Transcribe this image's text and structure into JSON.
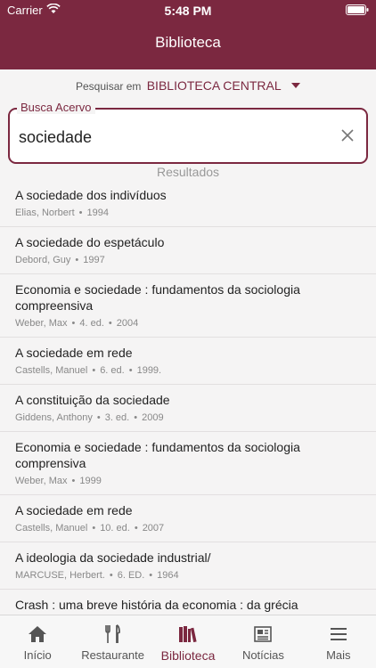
{
  "status_bar": {
    "carrier": "Carrier",
    "time": "5:48 PM"
  },
  "header": {
    "title": "Biblioteca"
  },
  "search": {
    "scope_label": "Pesquisar em",
    "scope_value": "BIBLIOTECA CENTRAL",
    "field_label": "Busca Acervo",
    "value": "sociedade"
  },
  "results": {
    "header": "Resultados",
    "items": [
      {
        "title": "A sociedade dos indivíduos",
        "meta": [
          "Elias, Norbert",
          "1994"
        ]
      },
      {
        "title": "A sociedade do espetáculo",
        "meta": [
          "Debord, Guy",
          "1997"
        ]
      },
      {
        "title": "Economia e sociedade : fundamentos da sociologia compreensiva",
        "meta": [
          "Weber, Max",
          "4. ed.",
          "2004"
        ]
      },
      {
        "title": "A sociedade em rede",
        "meta": [
          "Castells, Manuel",
          "6. ed.",
          "1999."
        ]
      },
      {
        "title": "A constituição da sociedade",
        "meta": [
          "Giddens, Anthony",
          "3. ed.",
          "2009"
        ]
      },
      {
        "title": "Economia e sociedade : fundamentos da sociologia comprensiva",
        "meta": [
          "Weber, Max",
          "1999"
        ]
      },
      {
        "title": "A sociedade em rede",
        "meta": [
          "Castells, Manuel",
          "10. ed.",
          "2007"
        ]
      },
      {
        "title": "A ideologia da sociedade industrial/",
        "meta": [
          "MARCUSE, Herbert.",
          "6. ED.",
          "1964"
        ]
      },
      {
        "title": "Crash : uma breve história da economia : da grécia",
        "meta": []
      }
    ]
  },
  "tabs": [
    {
      "label": "Início",
      "icon": "home-icon"
    },
    {
      "label": "Restaurante",
      "icon": "fork-knife-icon"
    },
    {
      "label": "Biblioteca",
      "icon": "books-icon"
    },
    {
      "label": "Notícias",
      "icon": "newspaper-icon"
    },
    {
      "label": "Mais",
      "icon": "menu-icon"
    }
  ],
  "colors": {
    "brand": "#7b2840",
    "background": "#f5f4f4"
  }
}
